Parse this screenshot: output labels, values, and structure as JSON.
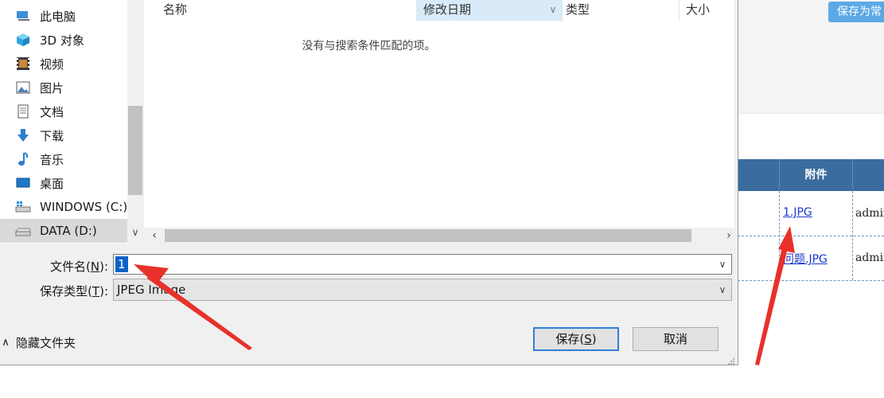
{
  "background_page": {
    "save_button_label": "保存为常",
    "table": {
      "header_attachment": "附件",
      "rows": [
        {
          "attachment": "1.JPG",
          "user": "admin"
        },
        {
          "attachment": "问题.JPG",
          "user": "admin"
        }
      ]
    }
  },
  "dialog": {
    "nav": {
      "items": [
        {
          "label": "此电脑",
          "icon": "computer-icon"
        },
        {
          "label": "3D 对象",
          "icon": "3d-objects-icon"
        },
        {
          "label": "视频",
          "icon": "video-icon"
        },
        {
          "label": "图片",
          "icon": "pictures-icon"
        },
        {
          "label": "文档",
          "icon": "documents-icon"
        },
        {
          "label": "下载",
          "icon": "download-icon"
        },
        {
          "label": "音乐",
          "icon": "music-icon"
        },
        {
          "label": "桌面",
          "icon": "desktop-icon"
        },
        {
          "label": "WINDOWS (C:)",
          "icon": "drive-c-icon"
        },
        {
          "label": "DATA (D:)",
          "icon": "drive-d-icon",
          "selected": true
        }
      ]
    },
    "file_list": {
      "columns": [
        "名称",
        "修改日期",
        "类型",
        "大小"
      ],
      "sorted_column": "修改日期",
      "empty_message": "没有与搜索条件匹配的项。"
    },
    "filename": {
      "label_prefix": "文件名(",
      "label_key": "N",
      "label_suffix": "):",
      "value": "1"
    },
    "filetype": {
      "label_prefix": "保存类型(",
      "label_key": "T",
      "label_suffix": "):",
      "value": "JPEG Image"
    },
    "hide_folders_label": "隐藏文件夹",
    "save_button": {
      "prefix": "保存(",
      "key": "S",
      "suffix": ")"
    },
    "cancel_button_label": "取消"
  },
  "colors": {
    "accent_selection": "#0a62c9",
    "sorted_column_bg": "#d9ebf9",
    "table_header_bg": "#3a6d9e",
    "link": "#1a37c9",
    "annotation_arrow": "#e8312a"
  }
}
